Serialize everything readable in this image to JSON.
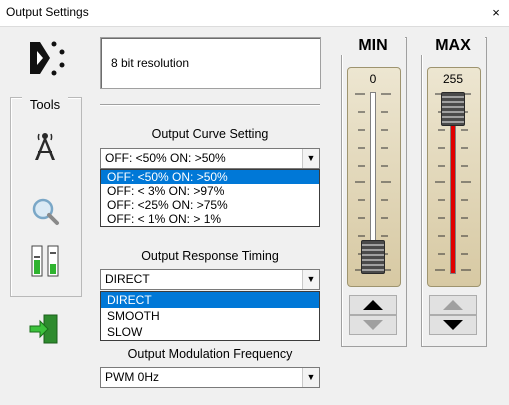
{
  "window": {
    "title": "Output Settings",
    "close_glyph": "×"
  },
  "tools": {
    "label": "Tools",
    "icons": [
      "antenna-tower-icon",
      "magnifier-icon",
      "level-meter-icon"
    ]
  },
  "exit_icon": "exit-door-icon",
  "resolution": {
    "text": "8 bit resolution"
  },
  "curve": {
    "label": "Output Curve Setting",
    "selected": "OFF: <50%  ON: >50%",
    "options": [
      "OFF: <50%  ON: >50%",
      "OFF: < 3%  ON: >97%",
      "OFF: <25%  ON: >75%",
      "OFF: < 1%  ON: > 1%"
    ],
    "highlighted_index": 0
  },
  "timing": {
    "label": "Output Response Timing",
    "selected": "DIRECT",
    "options": [
      "DIRECT",
      "SMOOTH",
      "SLOW"
    ],
    "highlighted_index": 0
  },
  "modulation": {
    "label": "Output Modulation Frequency",
    "selected": "PWM  0Hz"
  },
  "min_slider": {
    "title": "MIN",
    "value": "0",
    "level": 0,
    "up_enabled": true,
    "down_enabled": false
  },
  "max_slider": {
    "title": "MAX",
    "value": "255",
    "level": 1,
    "up_enabled": false,
    "down_enabled": true,
    "fill_color": "#e00000"
  },
  "colors": {
    "selection": "#0078d7",
    "track": "#e3d9bb",
    "max_fill": "#e00000"
  }
}
